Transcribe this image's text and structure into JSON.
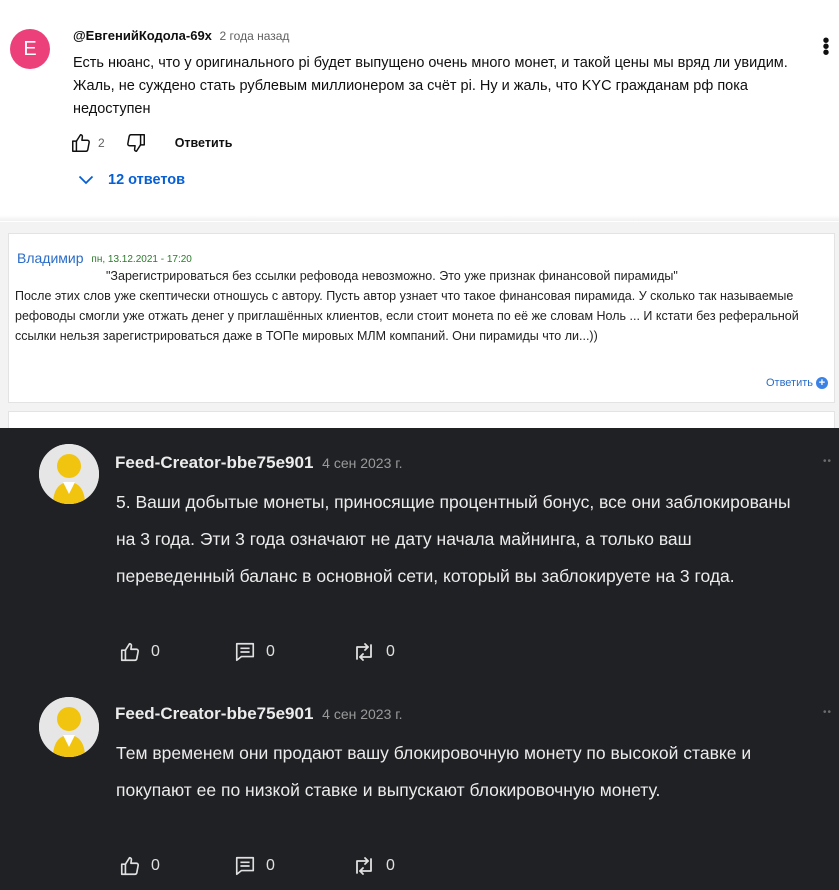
{
  "youtube_comment": {
    "avatar_letter": "E",
    "author": "@ЕвгенийКодола-69х",
    "time": "2 года назад",
    "text": "Есть нюанс, что у оригинального pi будет выпущено очень много монет, и такой цены мы вряд ли увидим. Жаль, не суждено стать рублевым миллионером за счёт pi. Ну и жаль, что KYC гражданам рф пока недоступен",
    "likes": "2",
    "reply_label": "Ответить",
    "replies_label": "12 ответов",
    "colors": {
      "avatar": "#ec407a",
      "replies": "#065fd4"
    }
  },
  "forum_comment": {
    "author": "Владимир",
    "date": "пн, 13.12.2021 - 17:20",
    "quote": "\"Зарегистрироваться без ссылки рефовода невозможно. Это уже признак финансовой пирамиды\"",
    "text": "После этих слов уже скептически отношусь с автору. Пусть автор узнает что такое финансовая пирамида. У сколько так называемые рефоводы смогли уже отжать денег у приглашённых клиентов, если стоит монета по её же словам Ноль ... И кстати без реферальной ссылки нельзя зарегистрироваться даже в ТОПе мировых МЛМ компаний. Они пирамиды что ли...))",
    "reply_label": "Ответить",
    "colors": {
      "author": "#2a6cc7",
      "date": "#2b7a2b"
    }
  },
  "dark_feed": {
    "comments": [
      {
        "author": "Feed-Creator-bbe75e901",
        "time": "4 сен 2023 г.",
        "text": "5. Ваши добытые монеты, приносящие процентный бонус, все они заблокированы на 3 года. Эти 3 года означают не дату начала майнинга, а только ваш переведенный баланс в основной сети, который вы заблокируете на 3 года.",
        "likes": "0",
        "comments": "0",
        "reposts": "0"
      },
      {
        "author": "Feed-Creator-bbe75e901",
        "time": "4 сен 2023 г.",
        "text": "Тем временем они продают вашу блокировочную монету по высокой ставке и покупают ее по низкой ставке и выпускают блокировочную монету.",
        "likes": "0",
        "comments": "0",
        "reposts": "0"
      }
    ],
    "colors": {
      "background": "#202124",
      "avatar_head": "#f1c40f"
    }
  }
}
